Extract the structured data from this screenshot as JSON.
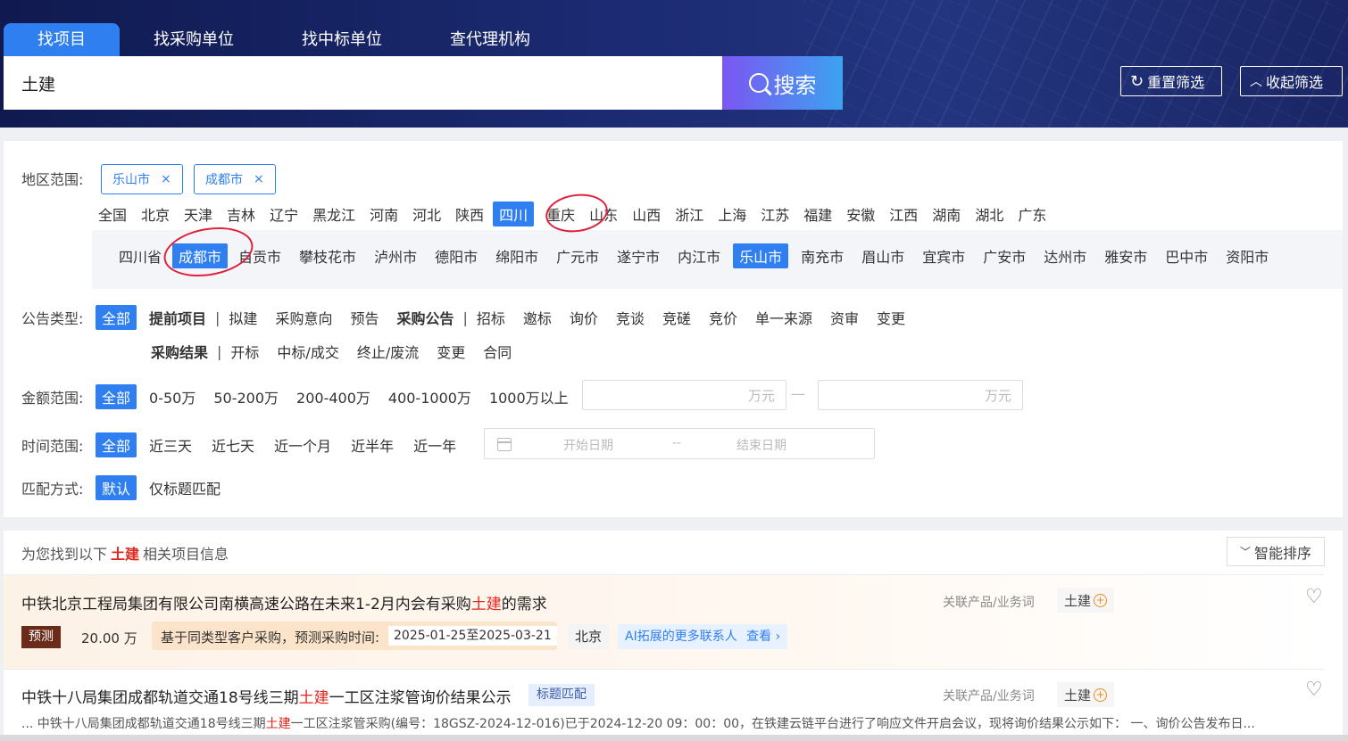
{
  "tabs": [
    {
      "label": "找项目"
    },
    {
      "label": "找采购单位"
    },
    {
      "label": "找中标单位"
    },
    {
      "label": "查代理机构"
    }
  ],
  "search": {
    "value": "土建",
    "button": "搜索"
  },
  "header_buttons": {
    "reset": "重置筛选",
    "collapse": "收起筛选"
  },
  "region": {
    "label": "地区范围:",
    "selected_chips": [
      "乐山市",
      "成都市"
    ],
    "chip_close": "×",
    "provinces": [
      "全国",
      "北京",
      "天津",
      "吉林",
      "辽宁",
      "黑龙江",
      "河南",
      "河北",
      "陕西",
      "四川",
      "重庆",
      "山东",
      "山西",
      "浙江",
      "上海",
      "江苏",
      "福建",
      "安徽",
      "江西",
      "湖南",
      "湖北",
      "广东"
    ],
    "selected_province": "四川",
    "cities": [
      "四川省",
      "成都市",
      "自贡市",
      "攀枝花市",
      "泸州市",
      "德阳市",
      "绵阳市",
      "广元市",
      "遂宁市",
      "内江市",
      "乐山市",
      "南充市",
      "眉山市",
      "宜宾市",
      "广安市",
      "达州市",
      "雅安市",
      "巴中市",
      "资阳市"
    ],
    "selected_cities": [
      "成都市",
      "乐山市"
    ]
  },
  "notice_type": {
    "label": "公告类型:",
    "all": "全部",
    "group1_title": "提前项目",
    "group1": [
      "拟建",
      "采购意向",
      "预告"
    ],
    "group2_title": "采购公告",
    "group2": [
      "招标",
      "邀标",
      "询价",
      "竞谈",
      "竞磋",
      "竞价",
      "单一来源",
      "资审",
      "变更"
    ],
    "group3_title": "采购结果",
    "group3": [
      "开标",
      "中标/成交",
      "终止/废流",
      "变更",
      "合同"
    ],
    "divider": "|"
  },
  "amount": {
    "label": "金额范围:",
    "all": "全部",
    "options": [
      "0-50万",
      "50-200万",
      "200-400万",
      "400-1000万",
      "1000万以上"
    ],
    "unit_placeholder": "万元",
    "range_dash": "—"
  },
  "time": {
    "label": "时间范围:",
    "all": "全部",
    "options": [
      "近三天",
      "近七天",
      "近一个月",
      "近半年",
      "近一年"
    ],
    "start_placeholder": "开始日期",
    "range_sep": "--",
    "end_placeholder": "结束日期"
  },
  "match": {
    "label": "匹配方式:",
    "options": [
      "默认",
      "仅标题匹配"
    ]
  },
  "results": {
    "prefix": "为您找到以下",
    "keyword": "土建",
    "suffix": "相关项目信息",
    "sort": "智能排序",
    "items": [
      {
        "title_pre": "中铁北京工程局集团有限公司南横高速公路在未来1-2月内会有采购",
        "title_hl": "土建",
        "title_post": "的需求",
        "rel_label": "关联产品/业务词",
        "rel_tag": "土建",
        "badge": "预测",
        "amount": "20.00 万",
        "predict_label": "基于同类型客户采购，预测采购时间:",
        "predict_dates": "2025-01-25至2025-03-21",
        "city": "北京",
        "ai_text": "AI拓展的更多联系人",
        "ai_link": "查看 ›"
      },
      {
        "title_pre": "中铁十八局集团成都轨道交通18号线三期",
        "title_hl": "土建",
        "title_post": "一工区注浆管询价结果公示",
        "match_badge": "标题匹配",
        "rel_label": "关联产品/业务词",
        "rel_tag": "土建",
        "snippet_pre": "... 中铁十八局集团成都轨道交通18号线三期",
        "snippet_hl": "土建",
        "snippet_post": "一工区注浆管采购(编号：18GSZ-2024-12-016)已于2024-12-20 09：00：00，在铁建云链平台进行了响应文件开启会议，现将询价结果公示如下： 一、询价公告发布日..."
      }
    ]
  },
  "colors": {
    "accent": "#2f7ff0",
    "highlight": "#e1261c",
    "annotation": "#e0213d"
  }
}
